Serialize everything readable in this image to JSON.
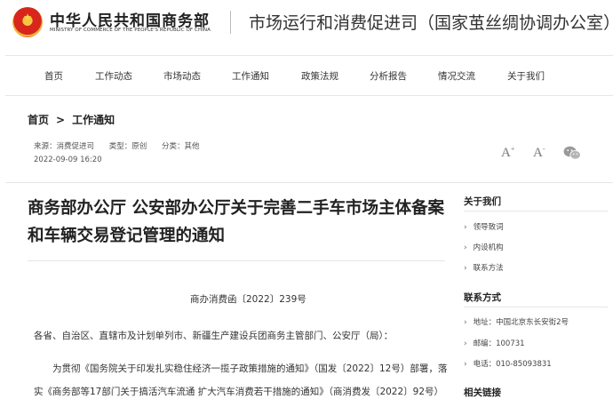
{
  "header": {
    "ministry_cn": "中华人民共和国商务部",
    "ministry_en": "MINISTRY OF COMMERCE OF THE PEOPLE'S REPUBLIC OF CHINA",
    "department": "市场运行和消费促进司（国家茧丝绸协调办公室）",
    "emblem_icon": "national-emblem-icon",
    "emblem_colors": [
      "#d8261c",
      "#f5c542"
    ]
  },
  "nav": {
    "items": [
      {
        "label": "首页"
      },
      {
        "label": "工作动态"
      },
      {
        "label": "市场动态"
      },
      {
        "label": "工作通知"
      },
      {
        "label": "政策法规"
      },
      {
        "label": "分析报告"
      },
      {
        "label": "情况交流"
      },
      {
        "label": "关于我们"
      }
    ]
  },
  "breadcrumb": {
    "home": "首页",
    "separator": ">",
    "current": "工作通知"
  },
  "meta": {
    "source": "来源：消费促进司",
    "type": "类型：原创",
    "category": "分类：其他",
    "date": "2022-09-09 16:20"
  },
  "tools": {
    "font_larger": "A",
    "font_smaller": "A",
    "font_plus": "+",
    "font_minus": "-",
    "share_icon": "wechat-icon"
  },
  "article": {
    "title": "商务部办公厅 公安部办公厅关于完善二手车市场主体备案和车辆交易登记管理的通知",
    "doc_number": "商办消费函〔2022〕239号",
    "addressee": "各省、自治区、直辖市及计划单列市、新疆生产建设兵团商务主管部门、公安厅（局）：",
    "paragraph_lines": [
      "为贯彻《国务院关于印发扎实稳住经济一揽子政策措施的通知》（国发〔2022〕12号）部署，落",
      "实《商务部等17部门关于搞活汽车流通 扩大汽车消费若干措施的通知》（商消费发〔2022〕92号）"
    ]
  },
  "sidebar": {
    "about_title": "关于我们",
    "about_items": [
      {
        "label": "领导致词"
      },
      {
        "label": "内设机构"
      },
      {
        "label": "联系方法"
      }
    ],
    "contact_title": "联系方式",
    "contact_items": [
      {
        "label": "地址：中国北京东长安街2号"
      },
      {
        "label": "邮编：100731"
      },
      {
        "label": "电话：010-85093831"
      }
    ],
    "links_title": "相关链接"
  },
  "colors": {
    "text": "#333333",
    "title": "#222222",
    "rule": "#e6e6e6",
    "muted": "#777777"
  }
}
